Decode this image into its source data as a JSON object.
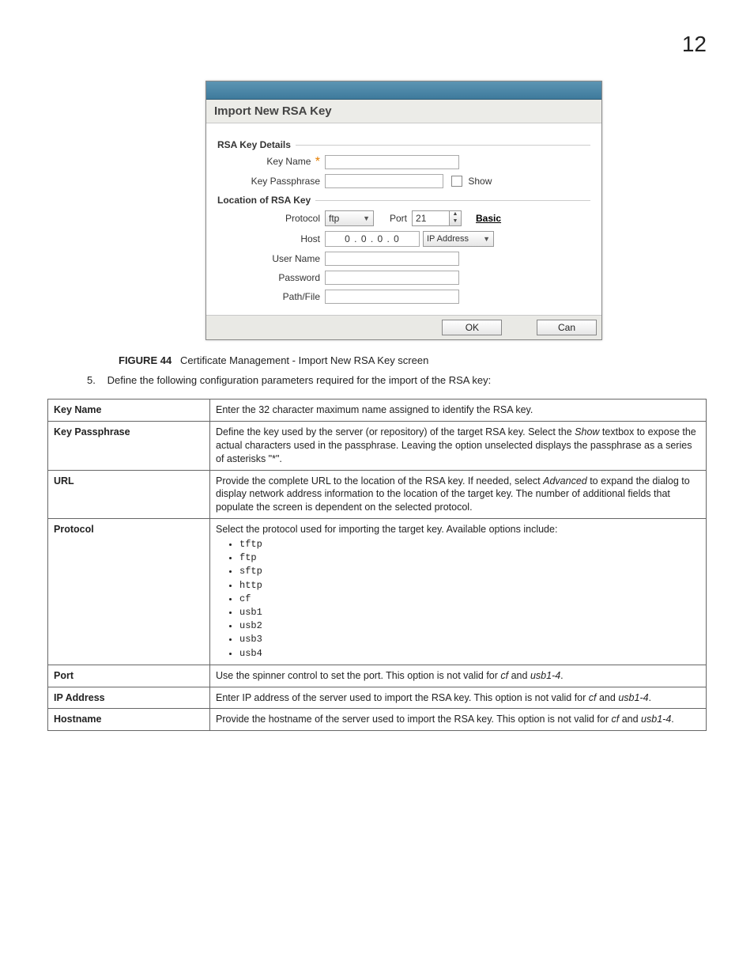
{
  "page_number": "12",
  "screenshot": {
    "dialog_title": "Import New RSA Key",
    "section1_title": "RSA Key Details",
    "key_name_label": "Key Name",
    "key_passphrase_label": "Key Passphrase",
    "show_label": "Show",
    "section2_title": "Location of RSA Key",
    "protocol_label": "Protocol",
    "protocol_value": "ftp",
    "port_label": "Port",
    "port_value": "21",
    "basic_link": "Basic",
    "host_label": "Host",
    "ip_value": "0   .   0   .   0   .   0",
    "ip_select": "IP Address",
    "username_label": "User Name",
    "password_label": "Password",
    "pathfile_label": "Path/File",
    "ok_button": "OK",
    "cancel_button": "Can"
  },
  "figure": {
    "label": "FIGURE 44",
    "title": "Certificate Management - Import New RSA Key screen"
  },
  "step": {
    "number": "5.",
    "text": "Define the following configuration parameters required for the import of the RSA key:"
  },
  "table": {
    "rows": [
      {
        "name": "Key Name",
        "desc_html": "Enter the 32 character maximum name assigned to identify the RSA key."
      },
      {
        "name": "Key Passphrase",
        "desc_html": "Define the key used by the server (or repository) of the target RSA key. Select the <span class='italic'>Show</span> textbox to expose the actual characters used in the passphrase. Leaving the option unselected displays the passphrase as a series of asterisks \"*\"."
      },
      {
        "name": "URL",
        "desc_html": "Provide the complete URL to the location of the RSA key. If needed, select <span class='italic'>Advanced</span> to expand the dialog to display network address information to the location of the target key. The number of additional fields that populate the screen is dependent on the selected protocol."
      },
      {
        "name": "Protocol",
        "desc_html": "Select the protocol used for importing the target key. Available options include:",
        "list": [
          "tftp",
          "ftp",
          "sftp",
          "http",
          "cf",
          "usb1",
          "usb2",
          "usb3",
          "usb4"
        ]
      },
      {
        "name": "Port",
        "desc_html": "Use the spinner control to set the port. This option is not valid for <span class='italic'>cf</span> and <span class='italic'>usb1-4</span>."
      },
      {
        "name": "IP Address",
        "desc_html": "Enter IP address of the server used to import the RSA key. This option is not valid for <span class='italic'>cf</span> and <span class='italic'>usb1-4</span>."
      },
      {
        "name": "Hostname",
        "desc_html": "Provide the hostname of the server used to import the RSA key. This option is not valid for <span class='italic'>cf</span> and <span class='italic'>usb1-4</span>."
      }
    ]
  }
}
